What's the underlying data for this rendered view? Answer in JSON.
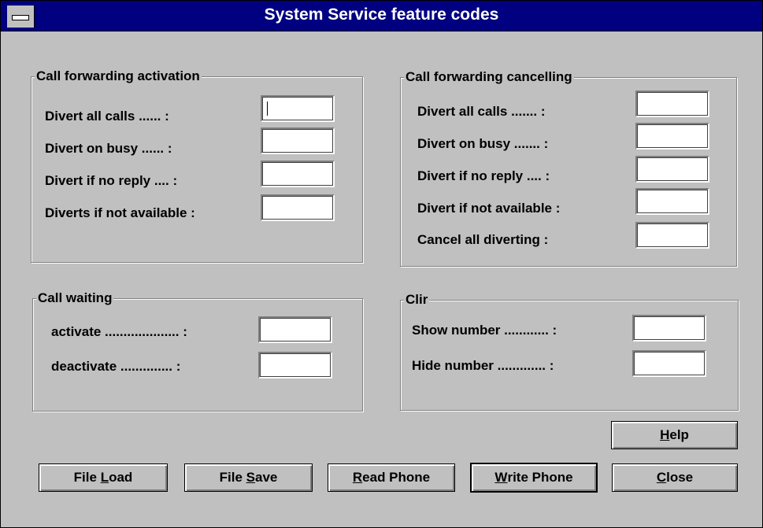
{
  "window": {
    "title": "System Service feature codes"
  },
  "call_forwarding_activation": {
    "legend": "Call forwarding activation",
    "labels": [
      "Divert all calls ...... :",
      "Divert on busy ...... :",
      "Divert if no reply .... :",
      "Diverts if not available :"
    ],
    "values": [
      "",
      "",
      "",
      ""
    ]
  },
  "call_forwarding_cancelling": {
    "legend": "Call forwarding cancelling",
    "labels": [
      "Divert all calls ....... :",
      "Divert on busy ....... :",
      "Divert if no reply .... :",
      "Divert if not available :",
      "Cancel all diverting :"
    ],
    "values": [
      "",
      "",
      "",
      "",
      ""
    ]
  },
  "call_waiting": {
    "legend": "Call waiting",
    "labels": [
      "activate .................... :",
      "deactivate .............. :"
    ],
    "values": [
      "",
      ""
    ]
  },
  "clir": {
    "legend": "Clir",
    "labels": [
      "Show number ............ :",
      "Hide number ............. :"
    ],
    "values": [
      "",
      ""
    ]
  },
  "buttons": {
    "help": {
      "pre": "",
      "key": "H",
      "post": "elp"
    },
    "file_load": {
      "pre": "File ",
      "key": "L",
      "post": "oad"
    },
    "file_save": {
      "pre": "File ",
      "key": "S",
      "post": "ave"
    },
    "read_phone": {
      "pre": "",
      "key": "R",
      "post": "ead Phone"
    },
    "write_phone": {
      "pre": "",
      "key": "W",
      "post": "rite Phone"
    },
    "close": {
      "pre": "",
      "key": "C",
      "post": "lose"
    }
  }
}
